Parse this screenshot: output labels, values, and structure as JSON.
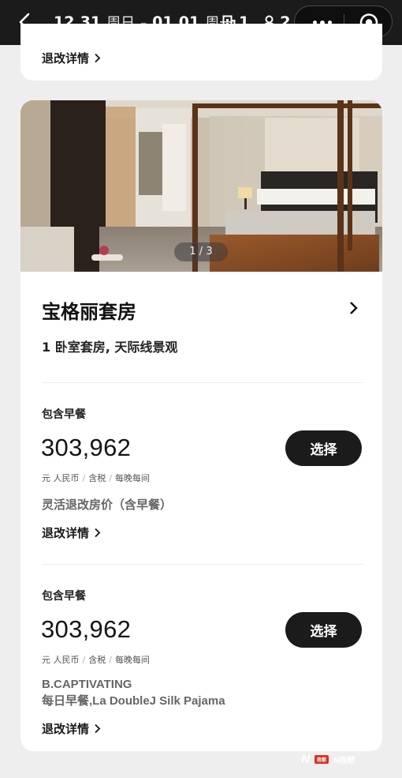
{
  "topbar": {
    "checkin_date": "12.31",
    "checkin_weekday": "周日",
    "separator": "–",
    "checkout_date": "01.01",
    "checkout_weekday": "周一",
    "rooms_count": "1",
    "guests_count": "2",
    "icons": [
      "back-icon",
      "room-icon",
      "person-icon",
      "more-dots-icon",
      "mini-program-close-icon"
    ]
  },
  "prev_card": {
    "refund_link": "退改详情"
  },
  "room": {
    "image_counter": "1 / 3",
    "title": "宝格丽套房",
    "subtitle": "1 卧室套房, 天际线景观"
  },
  "rates": [
    {
      "label": "包含早餐",
      "price": "303,962",
      "meta": [
        "元 人民币",
        "含税",
        "每晚每间"
      ],
      "select_label": "选择",
      "policy": "灵活退改房价（含早餐）",
      "refund_link": "退改详情"
    },
    {
      "label": "包含早餐",
      "price": "303,962",
      "meta": [
        "元 人民币",
        "含税",
        "每晚每间"
      ],
      "select_label": "选择",
      "package_line1": "B.CAPTIVATING",
      "package_line2": "每日早餐,La DoubleJ Silk Pajama",
      "refund_link": "退改详情"
    }
  ],
  "meta_separator": "/",
  "watermark": {
    "logo": "N",
    "badge": "南都",
    "text": "N视频"
  }
}
